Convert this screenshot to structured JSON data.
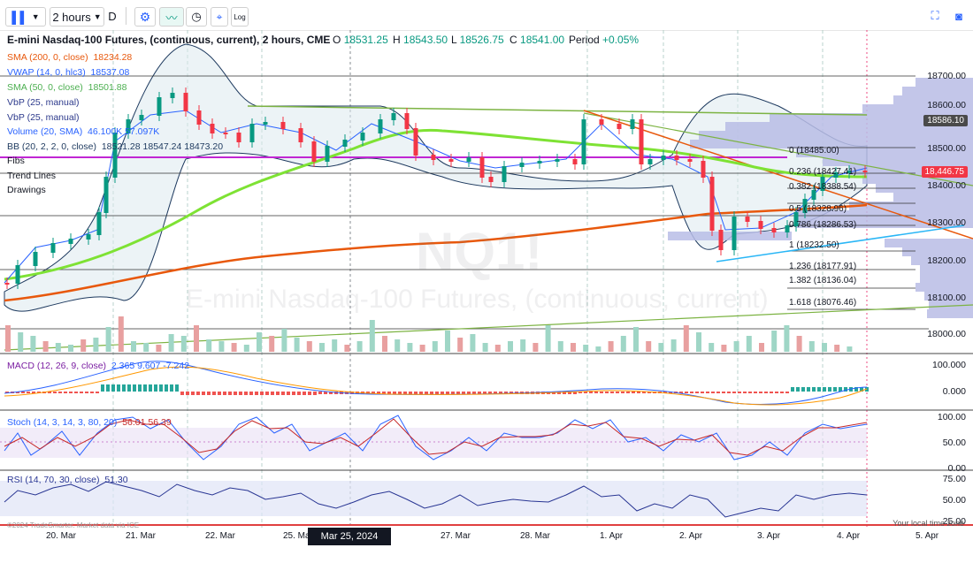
{
  "toolbar": {
    "interval": "2 hours",
    "d_label": "D",
    "log_label": "Log"
  },
  "header": {
    "title": "E-mini Nasdaq-100 Futures, (continuous, current), 2 hours, CME",
    "o_label": "O",
    "o_value": "18531.25",
    "h_label": "H",
    "h_value": "18543.50",
    "l_label": "L",
    "l_value": "18526.75",
    "c_label": "C",
    "c_value": "18541.00",
    "period_label": "Period",
    "period_value": "+0.05%"
  },
  "legend": {
    "sma200_name": "SMA (200, 0, close)",
    "sma200_value": "18234.28",
    "vwap_name": "VWAP (14, 0, hlc3)",
    "vwap_value": "18537.08",
    "sma50_name": "SMA (50, 0, close)",
    "sma50_value": "18501.88",
    "vbp1_name": "VbP (25, manual)",
    "vbp2_name": "VbP (25, manual)",
    "volume_name": "Volume (20, SMA)",
    "volume_value": "46.100K 57.097K",
    "bb_name": "BB (20, 2, 2, 0, close)",
    "bb_value": "18521.28 18547.24 18473.20",
    "fibs": "Fibs",
    "trend_lines": "Trend Lines",
    "drawings": "Drawings"
  },
  "indicators": {
    "macd_name": "MACD (12, 26, 9, close)",
    "macd_values": "2.365 9.607 -7.242",
    "stoch_name": "Stoch (14, 3, 14, 3, 80, 20)",
    "stoch_values": "56.01 56.39",
    "rsi_name": "RSI (14, 70, 30, close)",
    "rsi_value": "51.30"
  },
  "price_axis": [
    "18700.00",
    "18600.00",
    "18500.00",
    "18400.00",
    "18300.00",
    "18200.00",
    "18100.00",
    "18000.00"
  ],
  "macd_axis": [
    "100.000",
    "0.000"
  ],
  "stoch_axis": [
    "100.00",
    "50.00",
    "0.00"
  ],
  "rsi_axis": [
    "75.00",
    "50.00",
    "25.00"
  ],
  "price_labels": {
    "current": "18586.10",
    "last": "18,446.75"
  },
  "fibs": [
    {
      "label": "0 (18485.00)"
    },
    {
      "label": "0.236 (18427.41)"
    },
    {
      "label": "0.382 (18388.54)"
    },
    {
      "label": "0.5 (18328.96)"
    },
    {
      "label": "0.786 (18286.53)"
    },
    {
      "label": "1 (18232.50)"
    },
    {
      "label": "1.236 (18177.91)"
    },
    {
      "label": "1.382 (18136.04)"
    },
    {
      "label": "1.618 (18076.46)"
    }
  ],
  "x_labels": [
    "20. Mar",
    "21. Mar",
    "22. Mar",
    "25. Mar",
    "27. Mar",
    "28. Mar",
    "1. Apr",
    "2. Apr",
    "3. Apr",
    "4. Apr",
    "5. Apr"
  ],
  "crosshair_date": "Mar 25, 2024 16:00",
  "watermark": {
    "symbol": "NQ1!",
    "name": "E-mini Nasdaq-100 Futures, (continuous, current)"
  },
  "footer": {
    "credit": "©2024 TradeSmarter. Market data via ICE",
    "timezone": "Your local time zone"
  },
  "colors": {
    "up": "#089981",
    "down": "#f23645",
    "sma200": "#e8580c",
    "sma50": "#7ee234",
    "vwap": "#2962ff",
    "bb": "#1e3a5f",
    "fib": "#9c27b0"
  }
}
